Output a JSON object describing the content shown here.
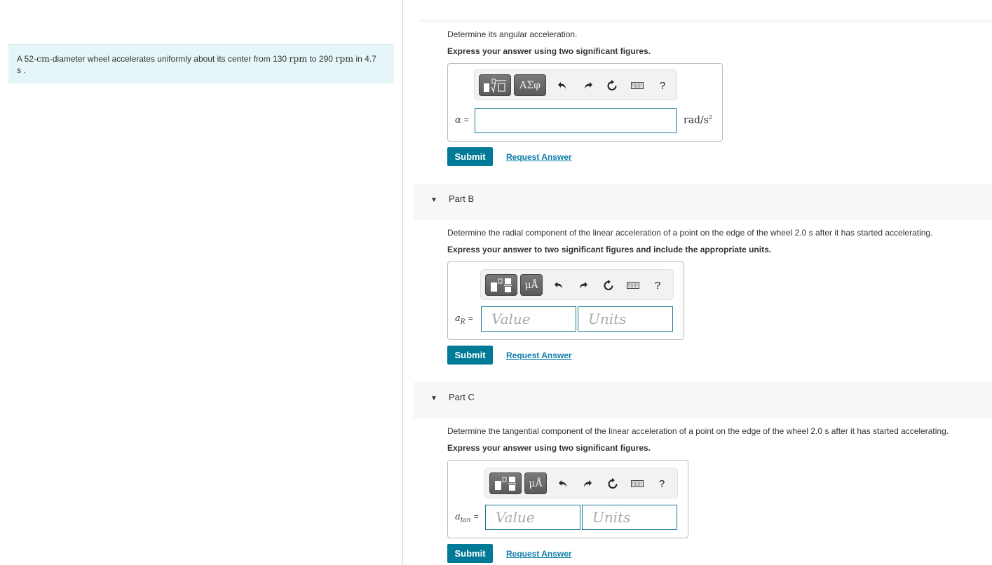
{
  "problem": {
    "text_parts": [
      "A 52-",
      "cm",
      "-diameter wheel accelerates uniformly about its center from 130 ",
      "rpm",
      " to 290 ",
      "rpm",
      " in 4.7 ",
      "s",
      " ."
    ]
  },
  "partA": {
    "question": "Determine its angular acceleration.",
    "instruction": "Express your answer using two significant figures.",
    "variable": "α",
    "equals": "=",
    "value": "",
    "unit_base": "rad/s",
    "unit_sup": "2",
    "toolbar": {
      "btn1": "templates",
      "btn2": "ΑΣφ",
      "help": "?"
    },
    "submit": "Submit",
    "request": "Request Answer"
  },
  "partB": {
    "title": "Part B",
    "question": "Determine the radial component of the linear acceleration of a point on the edge of the wheel 2.0 s after it has started accelerating.",
    "instruction": "Express your answer to two significant figures and include the appropriate units.",
    "variable": "a",
    "variable_sub": "R",
    "equals": "=",
    "value_placeholder": "Value",
    "units_placeholder": "Units",
    "toolbar": {
      "btn2": "μÅ",
      "help": "?"
    },
    "submit": "Submit",
    "request": "Request Answer"
  },
  "partC": {
    "title": "Part C",
    "question": "Determine the tangential component of the linear acceleration of a point on the edge of the wheel 2.0 s after it has started accelerating.",
    "instruction": "Express your answer using two significant figures.",
    "variable": "a",
    "variable_sub": "tan",
    "equals": "=",
    "value_placeholder": "Value",
    "units_placeholder": "Units",
    "toolbar": {
      "btn2": "μÅ",
      "help": "?"
    },
    "submit": "Submit",
    "request": "Request Answer"
  },
  "icons": {
    "caret": "▼",
    "undo": "undo-icon",
    "redo": "redo-icon",
    "reset": "reset-icon",
    "keyboard": "keyboard-icon"
  }
}
